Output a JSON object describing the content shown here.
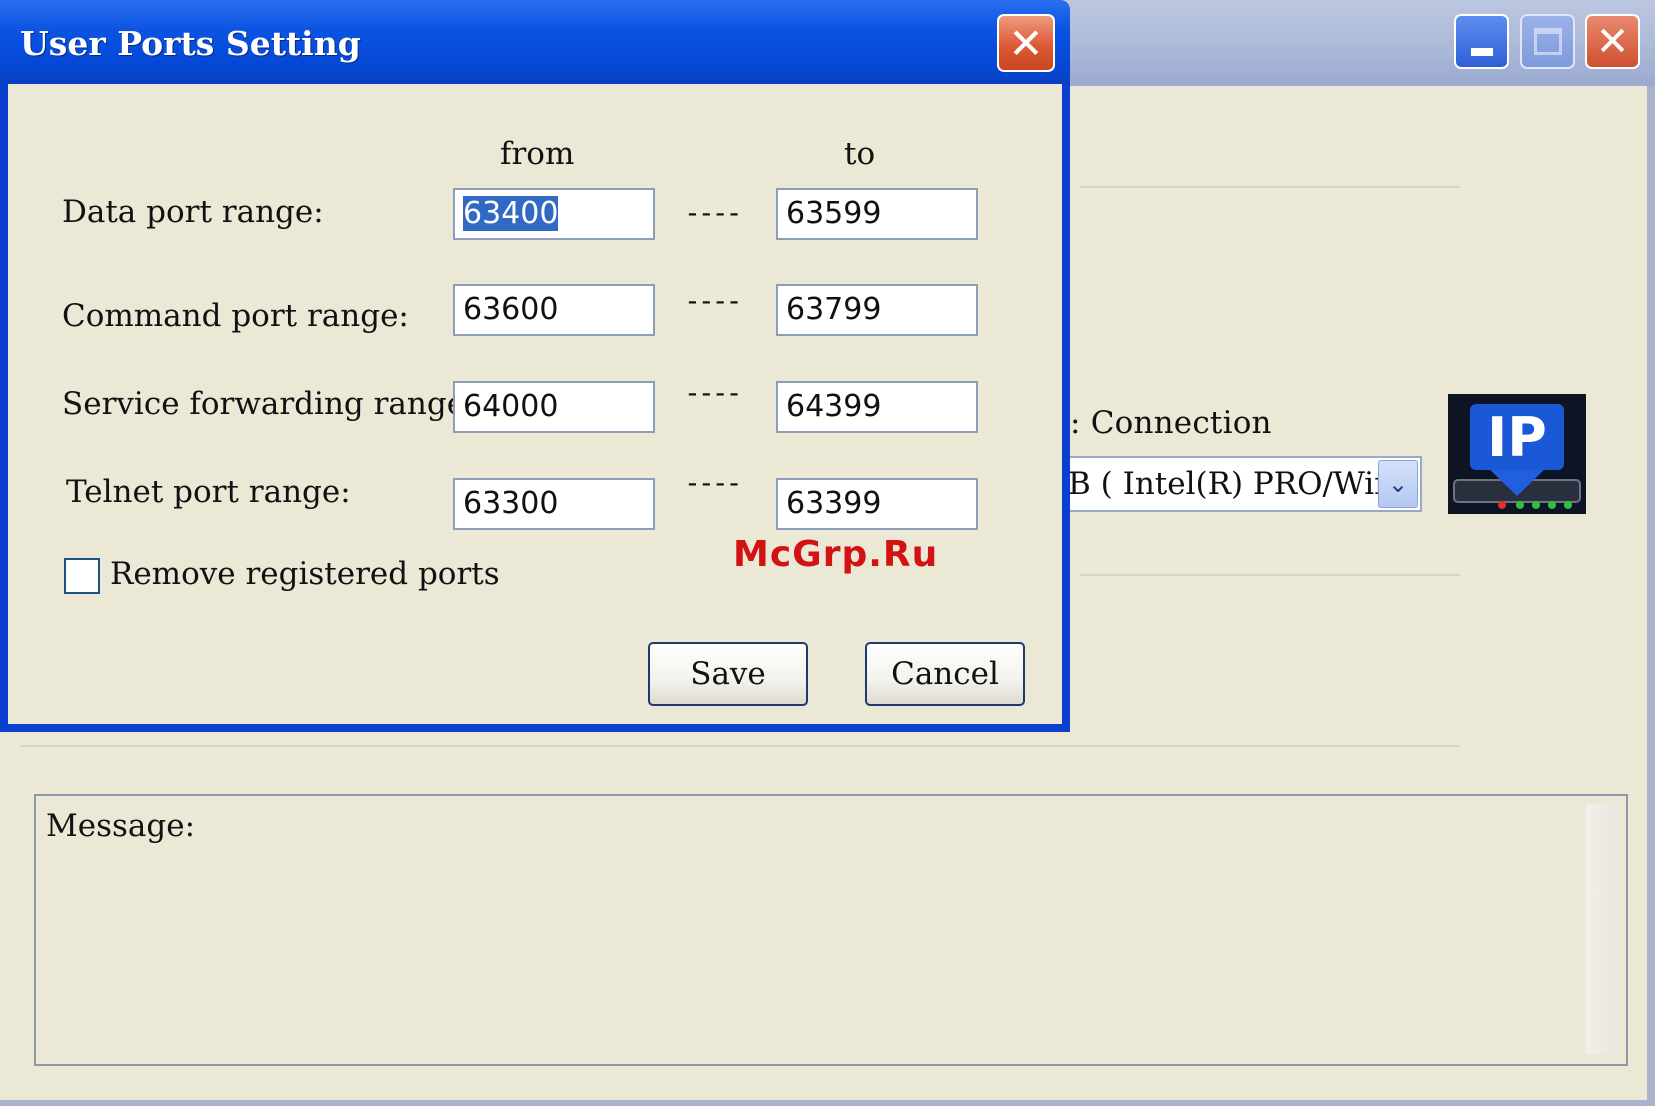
{
  "dialog": {
    "title": "User Ports Setting",
    "close_glyph": "✕",
    "headers": {
      "from": "from",
      "to": "to"
    },
    "rows": [
      {
        "label": "Data port range:",
        "from": "63400",
        "to": "63599",
        "separator": "----"
      },
      {
        "label": "Command port range:",
        "from": "63600",
        "to": "63799",
        "separator": "----"
      },
      {
        "label": "Service forwarding range:",
        "from": "64000",
        "to": "64399",
        "separator": "----"
      },
      {
        "label": "Telnet port range:",
        "from": "63300",
        "to": "63399",
        "separator": "----"
      }
    ],
    "checkbox": {
      "label": "Remove registered ports",
      "checked": false
    },
    "buttons": {
      "save": "Save",
      "cancel": "Cancel"
    }
  },
  "main_window": {
    "connection_label": ": Connection",
    "connection_select_value": "B  ( Intel(R) PRO/Win",
    "logo_text": "IP",
    "message_label": "Message:"
  },
  "watermark": "McGrp.Ru",
  "icons": {
    "minimize": "minimize-icon",
    "maximize": "maximize-icon",
    "close": "close-icon",
    "dropdown": "chevron-down-icon",
    "logo": "ip-logo-icon"
  },
  "colors": {
    "titlebar_blue": "#0548d6",
    "close_red": "#dd5a38",
    "selection_blue": "#316ac5",
    "window_bg": "#ebe8d6",
    "watermark_red": "#d31313"
  }
}
